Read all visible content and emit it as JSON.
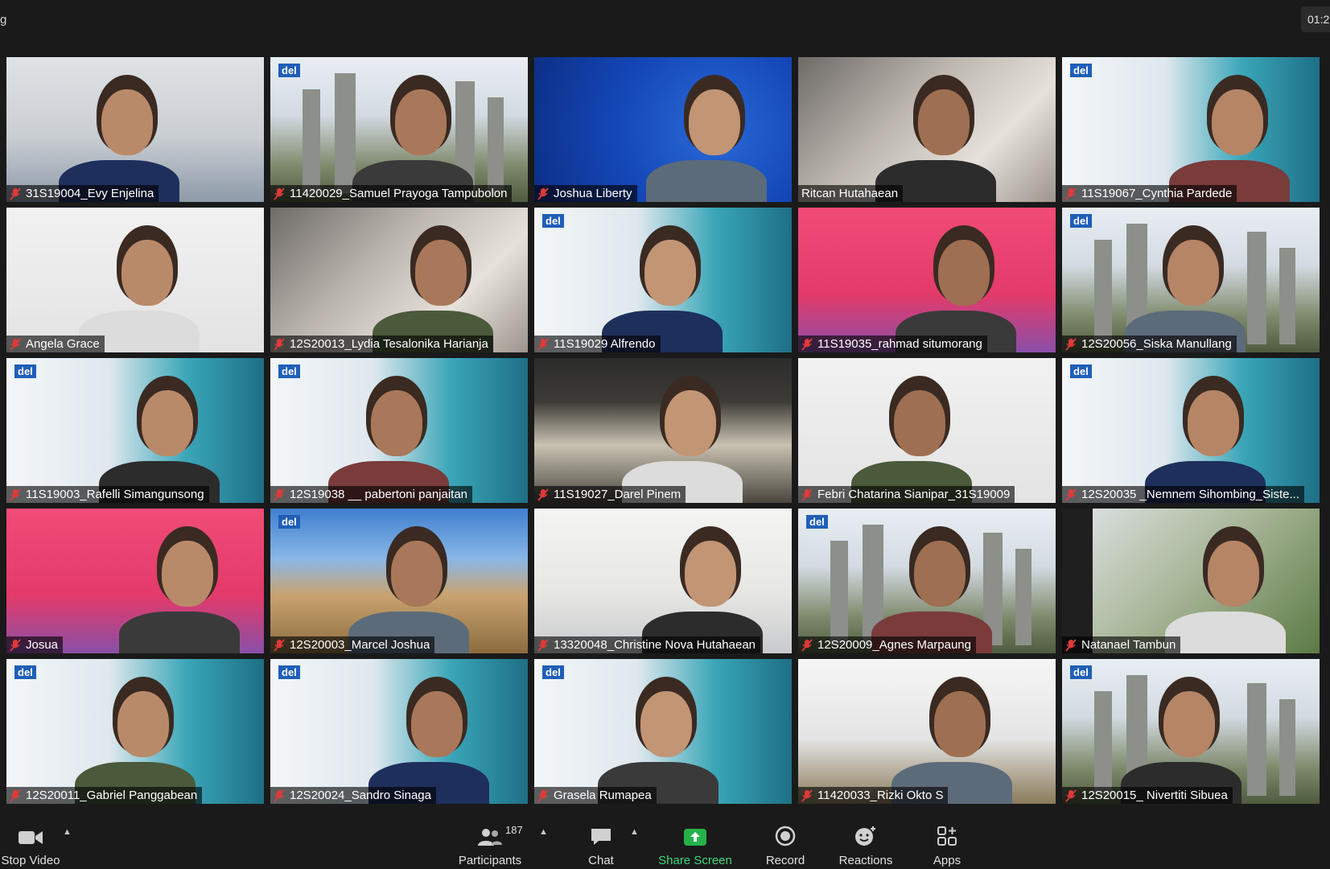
{
  "window": {
    "title_fragment": "g",
    "timer": "01:2"
  },
  "participants": [
    {
      "name": "31S19004_Evy Enjelina",
      "muted": true,
      "bg": "room"
    },
    {
      "name": "11420029_Samuel Prayoga Tampubolon",
      "muted": true,
      "bg": "monument",
      "logo": "del"
    },
    {
      "name": "Joshua Liberty",
      "muted": true,
      "bg": "blue"
    },
    {
      "name": "Ritcan Hutahaean",
      "muted": false,
      "bg": "blur",
      "active": true
    },
    {
      "name": "11S19067_Cynthia Pardede",
      "muted": true,
      "bg": "campus",
      "logo": "del"
    },
    {
      "name": "Angela Grace",
      "muted": true,
      "bg": "white"
    },
    {
      "name": "12S20013_Lydia Tesalonika Harianja",
      "muted": true,
      "bg": "blur"
    },
    {
      "name": "11S19029 Alfrendo",
      "muted": true,
      "bg": "campus",
      "logo": "del"
    },
    {
      "name": "11S19035_rahmad situmorang",
      "muted": true,
      "bg": "pink"
    },
    {
      "name": "12S20056_Siska Manullang",
      "muted": true,
      "bg": "monument",
      "logo": "del"
    },
    {
      "name": "11S19003_Rafelli Simangunsong",
      "muted": true,
      "bg": "campus",
      "logo": "del"
    },
    {
      "name": "12S19038 __ pabertoni panjaitan",
      "muted": true,
      "bg": "campus",
      "logo": "del"
    },
    {
      "name": "11S19027_Darel Pinem",
      "muted": true,
      "bg": "window"
    },
    {
      "name": "Febri Chatarina Sianipar_31S19009",
      "muted": true,
      "bg": "white"
    },
    {
      "name": "12S20035 _Nemnem Sihombing_Siste...",
      "muted": true,
      "bg": "campus",
      "logo": "del"
    },
    {
      "name": "Josua",
      "muted": true,
      "bg": "pink"
    },
    {
      "name": "12S20003_Marcel Joshua",
      "muted": true,
      "bg": "sky",
      "logo": "del"
    },
    {
      "name": "13320048_Christine Nova Hutahaean",
      "muted": true,
      "bg": "ceiling"
    },
    {
      "name": "12S20009_Agnes Marpaung",
      "muted": true,
      "bg": "monument",
      "logo": "del"
    },
    {
      "name": "Natanael Tambun",
      "muted": true,
      "bg": "aerial",
      "letterbox": true
    },
    {
      "name": "12S20011_Gabriel Panggabean",
      "muted": true,
      "bg": "campus",
      "logo": "del"
    },
    {
      "name": "12S20024_Sandro Sinaga",
      "muted": true,
      "bg": "campus",
      "logo": "del"
    },
    {
      "name": "Grasela Rumapea",
      "muted": true,
      "bg": "campus",
      "logo": "del"
    },
    {
      "name": "11420033_Rizki Okto S",
      "muted": true,
      "bg": "outdoor"
    },
    {
      "name": "12S20015_ Nivertiti Sibuea",
      "muted": true,
      "bg": "monument",
      "logo": "del"
    }
  ],
  "toolbar": {
    "stop_video": "Stop Video",
    "participants": "Participants",
    "participants_count": "187",
    "chat": "Chat",
    "share_screen": "Share Screen",
    "record": "Record",
    "reactions": "Reactions",
    "apps": "Apps"
  },
  "colors": {
    "active_speaker": "#cde33a",
    "share_green": "#26b24a",
    "mute_red": "#e03a3a"
  }
}
